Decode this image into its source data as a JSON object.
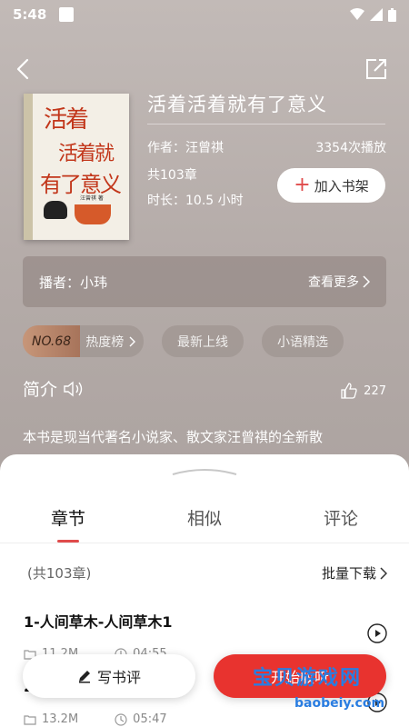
{
  "status": {
    "time": "5:48"
  },
  "book": {
    "title": "活着活着就有了意义",
    "author": "作者：汪曾祺",
    "plays": "3354次播放",
    "chapters": "共103章",
    "duration": "时长：10.5 小时",
    "add_shelf": "加入书架",
    "cover": {
      "line1": "活着",
      "line2": "活着就",
      "line3": "有了意义",
      "author": "汪曾祺 著"
    }
  },
  "narrator": {
    "label": "播者：小玮",
    "more": "查看更多"
  },
  "tags": [
    {
      "rank": "NO.68",
      "label": "热度榜"
    },
    {
      "label": "最新上线"
    },
    {
      "label": "小语精选"
    }
  ],
  "intro": {
    "heading": "简介",
    "likes": "227",
    "text": "本书是现当代著名小说家、散文家汪曾祺的全新散"
  },
  "sheet": {
    "tabs": [
      "章节",
      "相似",
      "评论"
    ],
    "count": "(共103章)",
    "batch": "批量下载",
    "items": [
      {
        "title": "1-人间草木-人间草木1",
        "size": "11.2M",
        "time": "04:55"
      },
      {
        "title": "2",
        "size": "13.2M",
        "time": "05:47"
      }
    ]
  },
  "actions": {
    "review": "写书评",
    "listen": "开始收听"
  },
  "watermark": {
    "text": "宝贝游戏网",
    "url": "baobeiy.com"
  }
}
